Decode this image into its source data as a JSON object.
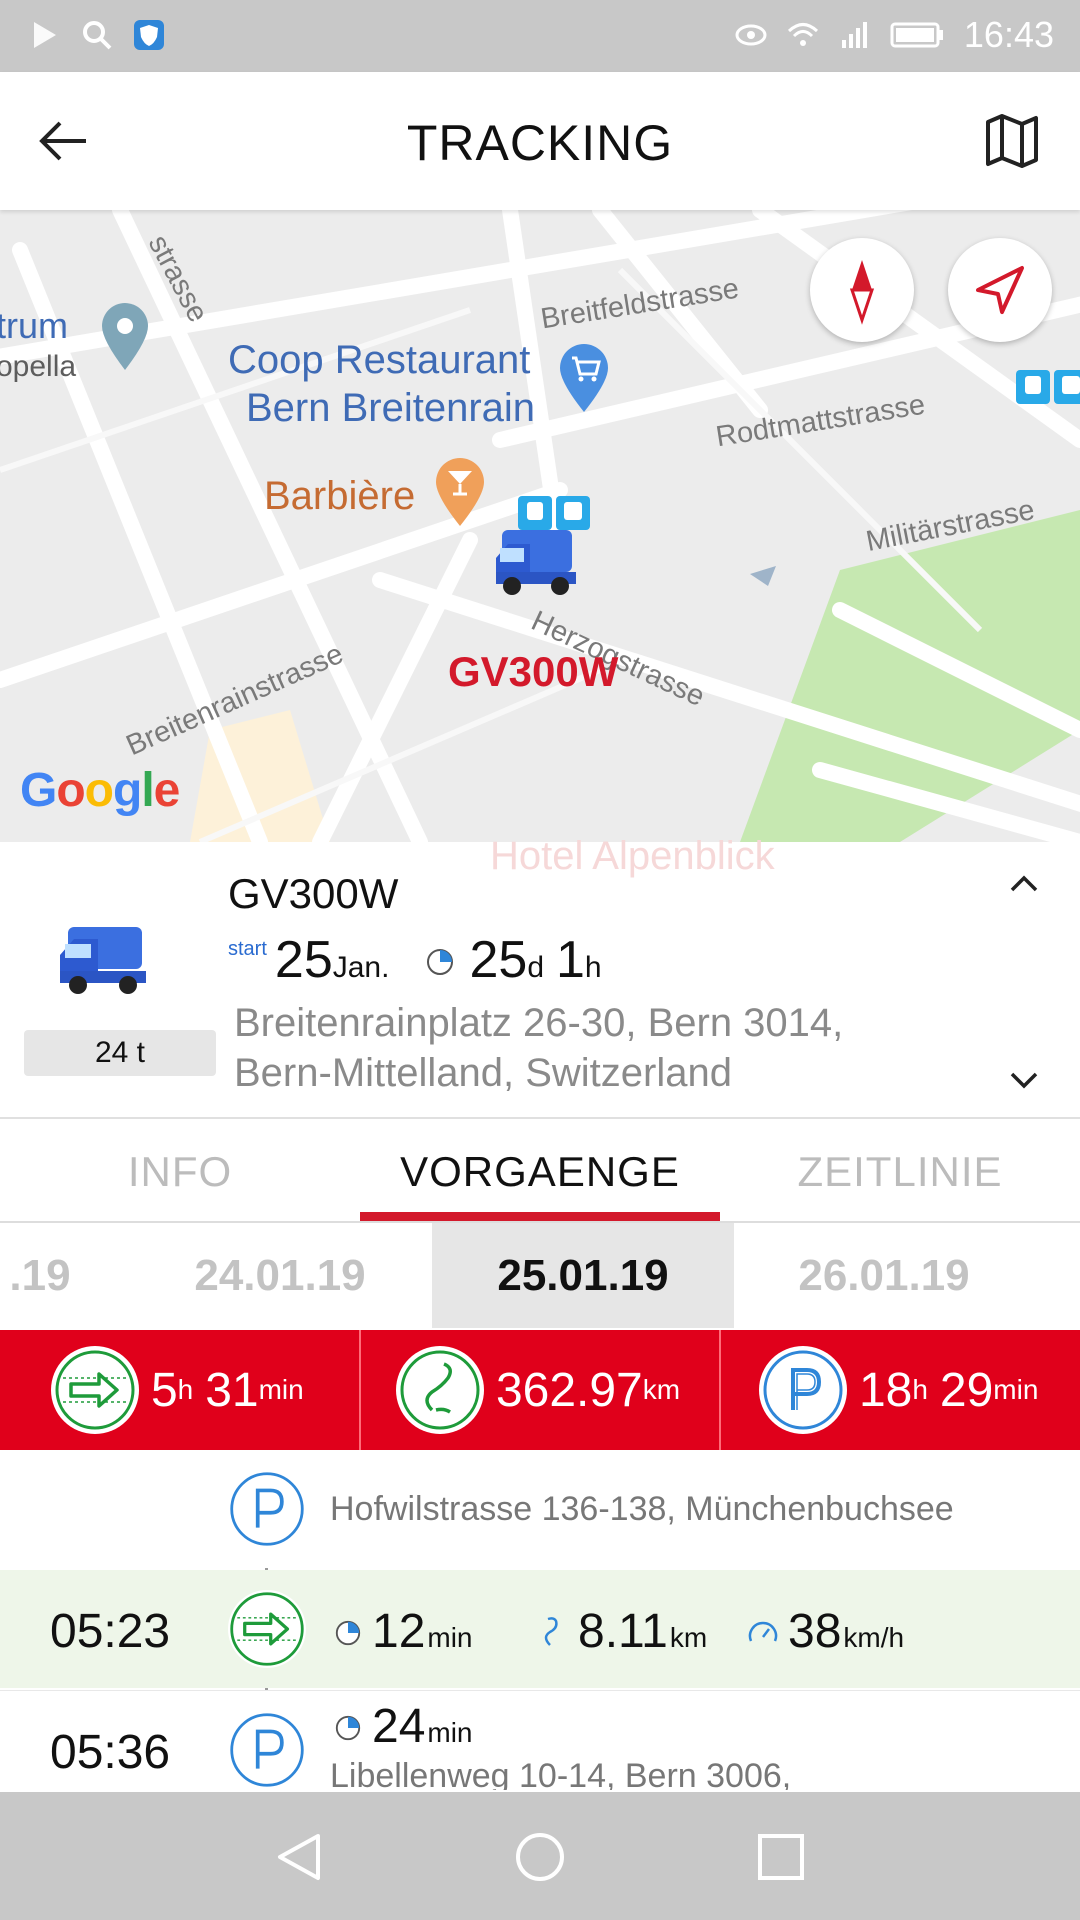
{
  "status_bar": {
    "time": "16:43"
  },
  "app_bar": {
    "title": "TRACKING",
    "back_icon": "back-arrow-icon",
    "map_icon": "map-icon"
  },
  "map": {
    "streets": [
      "strasse",
      "Breitfeldstrasse",
      "Rodtmattstrasse",
      "Militärstrasse",
      "Herzogstrasse",
      "Breitenrainstrasse"
    ],
    "poi_coop_line1": "Coop Restaurant",
    "poi_coop_line2": "Bern Breitenrain",
    "poi_barbiere": "Barbière",
    "poi_left_line1": "trum",
    "poi_left_line2": "opella",
    "vehicle_label": "GV300W",
    "google_logo": "Google",
    "faded_label": "Hotel Alpenblick"
  },
  "vehicle": {
    "name": "GV300W",
    "weight": "24 t",
    "start_label": "start",
    "start_day": "25",
    "start_month": "Jan.",
    "duration_days": "25",
    "duration_days_unit": "d",
    "duration_hours": "1",
    "duration_hours_unit": "h",
    "address_line1": "Breitenrainplatz 26-30, Bern 3014,",
    "address_line2": "Bern-Mittelland, Switzerland"
  },
  "tabs": [
    "INFO",
    "VORGAENGE",
    "ZEITLINIE"
  ],
  "active_tab": "VORGAENGE",
  "dates": [
    ".19",
    "24.01.19",
    "25.01.19",
    "26.01.19"
  ],
  "active_date": "25.01.19",
  "summary": {
    "drive_h": "5",
    "drive_h_unit": "h",
    "drive_min": "31",
    "drive_min_unit": "min",
    "distance": "362.97",
    "distance_unit": "km",
    "park_h": "18",
    "park_h_unit": "h",
    "park_min": "29",
    "park_min_unit": "min"
  },
  "timeline": [
    {
      "type": "park",
      "time": "",
      "address": "Hofwilstrasse 136-138, Münchenbuchsee"
    },
    {
      "type": "drive",
      "time": "05:23",
      "duration": "12",
      "duration_unit": "min",
      "distance": "8.11",
      "distance_unit": "km",
      "speed": "38",
      "speed_unit": "km/h"
    },
    {
      "type": "park",
      "time": "05:36",
      "duration": "24",
      "duration_unit": "min",
      "address": "Libellenweg 10-14, Bern 3006,"
    }
  ],
  "colors": {
    "accent": "#e0001b",
    "drive_green": "#1e9b3a",
    "park_blue": "#2f86d8",
    "drive_row_bg": "#eef6e9"
  }
}
